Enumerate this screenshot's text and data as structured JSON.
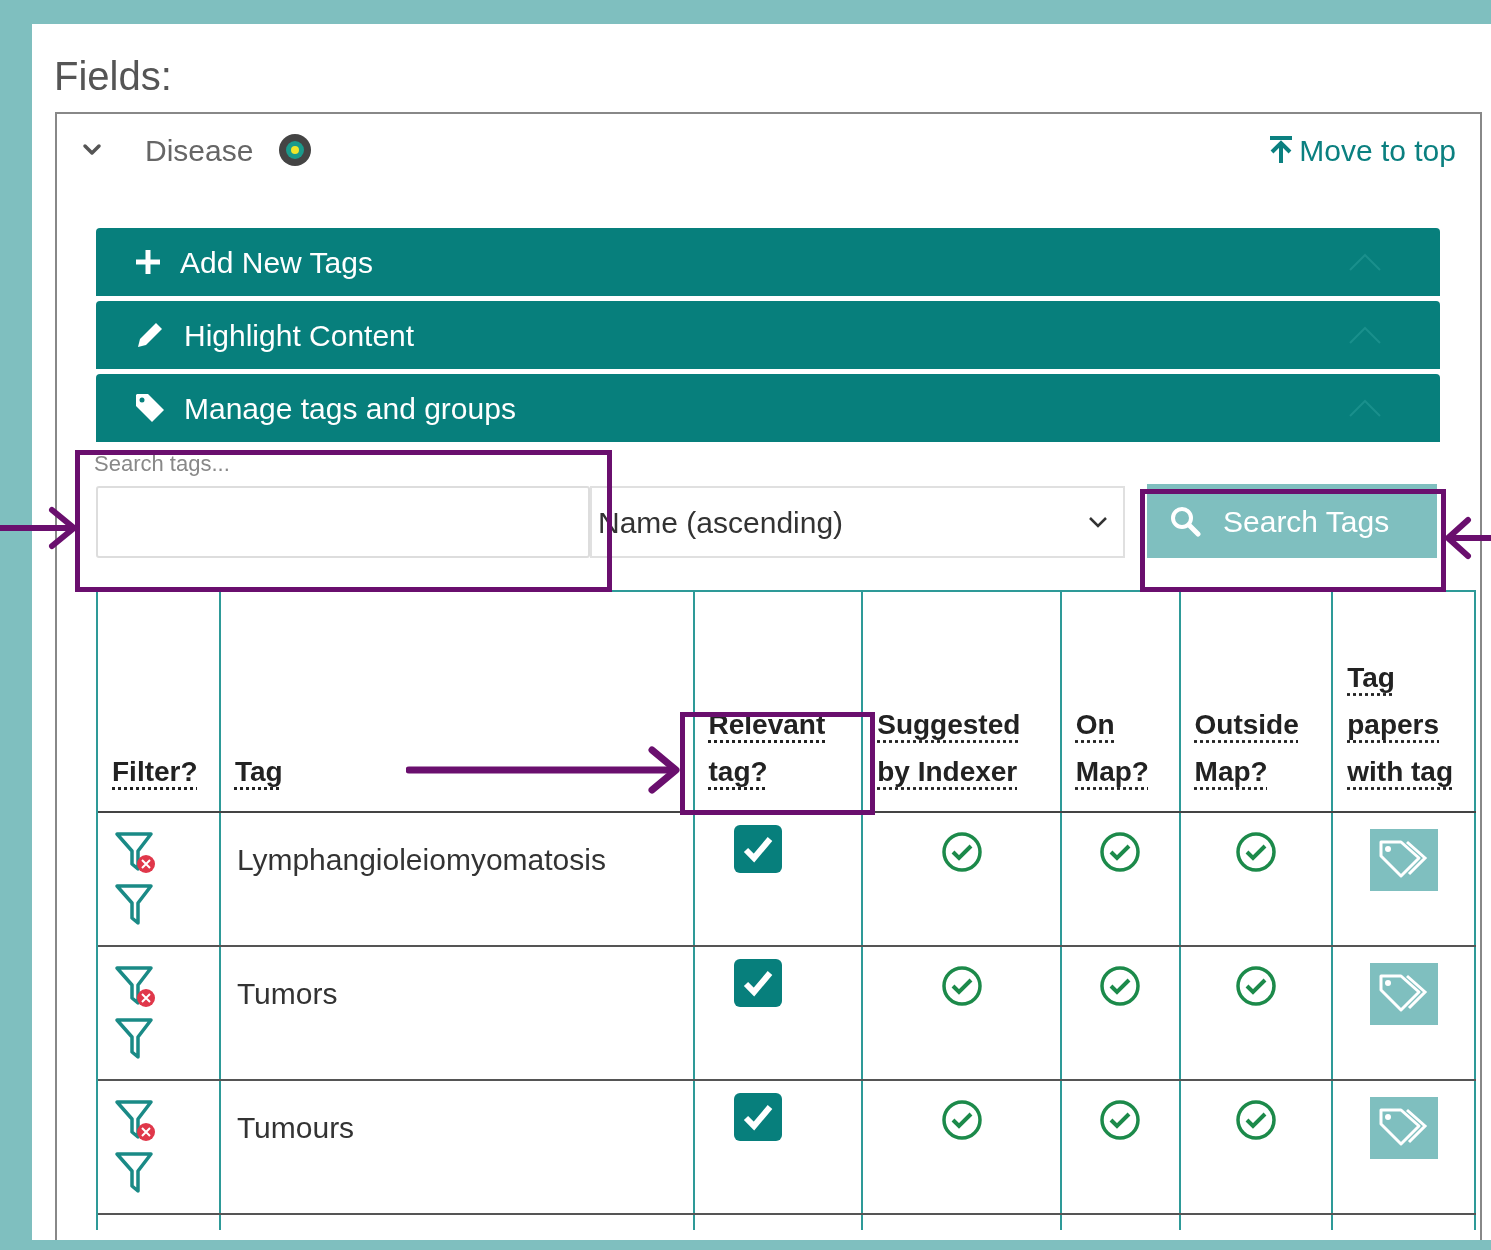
{
  "heading": "Fields:",
  "field": {
    "name": "Disease",
    "expanded": true,
    "move_link": "Move to top"
  },
  "sections": [
    {
      "label": "Add New Tags",
      "kind": "add"
    },
    {
      "label": "Highlight Content",
      "kind": "highlight"
    },
    {
      "label": "Manage tags and groups",
      "kind": "manage"
    }
  ],
  "search": {
    "label": "Search tags..."
  },
  "sort": {
    "value": "Name (ascending)"
  },
  "search_button": "Search Tags",
  "table": {
    "columns": [
      "Filter?",
      "Tag",
      "Relevant tag?",
      "Suggested by Indexer",
      "On Map?",
      "Outside Map?",
      "Tag papers with tag"
    ],
    "rows": [
      {
        "tag": "Lymphangioleiomyomatosis",
        "relevant": true,
        "suggested": true,
        "on_map": true,
        "outside_map": true
      },
      {
        "tag": "Tumors",
        "relevant": true,
        "suggested": true,
        "on_map": true,
        "outside_map": true
      },
      {
        "tag": "Tumours",
        "relevant": true,
        "suggested": true,
        "on_map": true,
        "outside_map": true
      }
    ]
  }
}
